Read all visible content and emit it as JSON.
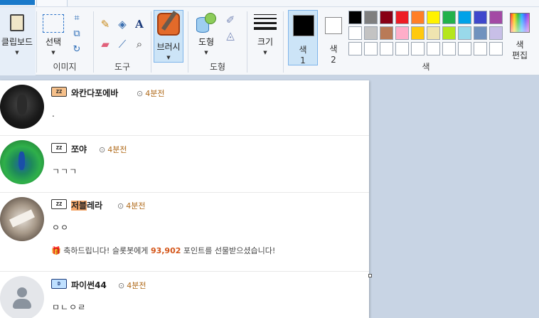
{
  "tabs": {
    "home_label": "",
    "view_label": ""
  },
  "ribbon": {
    "clipboard": {
      "label": "클립보드"
    },
    "image": {
      "select_label": "선택",
      "group_label": "이미지"
    },
    "tools": {
      "group_label": "도구",
      "text_tool_glyph": "A"
    },
    "brushes": {
      "label": "브러시"
    },
    "shapes": {
      "label": "도형",
      "group_label": "도형"
    },
    "size": {
      "label": "크기"
    },
    "colors": {
      "color1_label": "색\n1",
      "color1_line1": "색",
      "color1_line2": "1",
      "color2_line1": "색",
      "color2_line2": "2",
      "color1_value": "#000000",
      "color2_value": "#ffffff",
      "group_label": "색",
      "edit_line1": "색",
      "edit_line2": "편집",
      "palette_row1": [
        "#000000",
        "#7f7f7f",
        "#880015",
        "#ed1c24",
        "#ff7f27",
        "#fff200",
        "#22b14c",
        "#00a2e8",
        "#3f48cc",
        "#a349a4"
      ],
      "palette_row2": [
        "#ffffff",
        "#c3c3c3",
        "#b97a57",
        "#ffaec9",
        "#ffc90e",
        "#efe4b0",
        "#b5e61d",
        "#99d9ea",
        "#7092be",
        "#c8bfe7"
      ],
      "palette_row3": [
        "#ffffff",
        "#ffffff",
        "#ffffff",
        "#ffffff",
        "#ffffff",
        "#ffffff",
        "#ffffff",
        "#ffffff",
        "#ffffff",
        "#ffffff"
      ]
    }
  },
  "comments": [
    {
      "badge": "ZZ",
      "nick": "와칸다포에바",
      "time": "4분전",
      "text": "."
    },
    {
      "badge": "ZZ",
      "nick": "쪼야",
      "time": "4분전",
      "text": "ㄱㄱㄱ"
    },
    {
      "badge": "ZZ",
      "nick_highlight": "저블",
      "nick_rest": "레라",
      "time": "4분전",
      "text": "ㅇㅇ",
      "gift_prefix": "축하드립니다! 슬롯봇에게 ",
      "gift_points": "93,902",
      "gift_suffix": " 포인트를 선물받으셨습니다!"
    },
    {
      "badge": "D",
      "nick": "파이썬44",
      "time": "4분전",
      "text": "ㅁㄴㅇㄹ"
    }
  ]
}
